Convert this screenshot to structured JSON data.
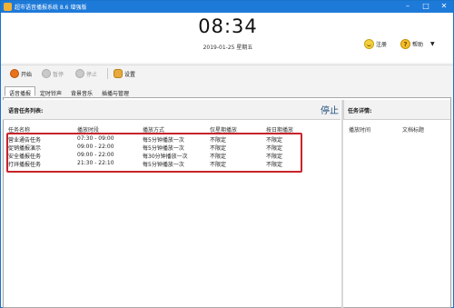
{
  "window": {
    "title": "超市语音播报系统 8.6 增强版"
  },
  "header": {
    "clock": "08:34",
    "date": "2019-01-25",
    "weekday": "星期五",
    "register_label": "注册",
    "help_label": "帮助"
  },
  "toolbar": {
    "start_label": "开始",
    "pause_label": "暂停",
    "stop_label": "停止",
    "settings_label": "设置"
  },
  "tabs": [
    "语音播报",
    "定时铃声",
    "背景音乐",
    "插播与管理"
  ],
  "left_panel": {
    "title": "语音任务列表:",
    "status": "停止",
    "columns": [
      "任务名称",
      "播放时段",
      "播放方式",
      "仅星期播放",
      "按日期播放"
    ],
    "rows": [
      [
        "营业通告任务",
        "07:30 - 09:00",
        "每5分钟播放一次",
        "不限定",
        "不限定"
      ],
      [
        "促销播报演示",
        "09:00 - 22:00",
        "每5分钟播放一次",
        "不限定",
        "不限定"
      ],
      [
        "安全播报任务",
        "09:00 - 22:00",
        "每30分钟播放一次",
        "不限定",
        "不限定"
      ],
      [
        "打烊播报任务",
        "21:30 - 22:10",
        "每5分钟播放一次",
        "不限定",
        "不限定"
      ]
    ]
  },
  "right_panel": {
    "title": "任务详情:",
    "columns": [
      "播放时间",
      "文档标题"
    ]
  },
  "colors": {
    "titlebar": "#1e7ad9",
    "highlight": "#c8242a"
  }
}
